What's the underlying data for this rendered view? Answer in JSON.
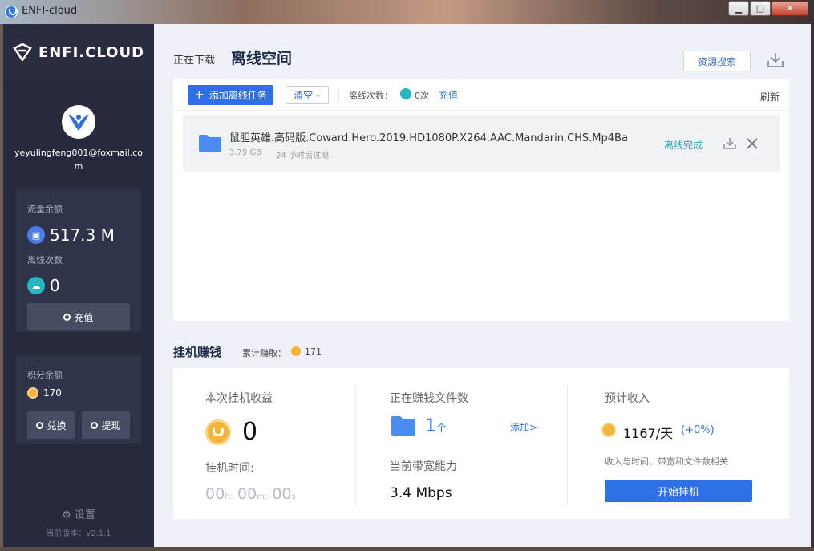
{
  "window": {
    "title": "ENFI-cloud",
    "min_label": "▁",
    "max_label": "□",
    "close_label": "✕"
  },
  "sidebar": {
    "brand": "ENFI.CLOUD",
    "username": "yeyulingfeng001@foxmail.com",
    "balance_card": {
      "traffic_label": "流量余额",
      "traffic_value": "517.3 M",
      "offline_label": "离线次数",
      "offline_value": "0",
      "recharge_label": "充值"
    },
    "points_card": {
      "label": "积分余额",
      "value": "170",
      "exchange_label": "兑换",
      "withdraw_label": "提现"
    },
    "settings_label": "设置",
    "version": "当前版本：v2.1.1"
  },
  "main": {
    "tab_downloading": "正在下载",
    "tab_offline": "离线空间",
    "resource_search": "资源搜索",
    "toolbar": {
      "add_task": "添加离线任务",
      "clear": "清空",
      "offline_count_label": "离线次数：",
      "offline_count_value": "0次",
      "recharge": "充值",
      "refresh": "刷新"
    },
    "tasks": [
      {
        "name": "鼠胆英雄.高码版.Coward.Hero.2019.HD1080P.X264.AAC.Mandarin.CHS.Mp4Ba",
        "size": "3.79 GB",
        "expire": "24 小时后过期",
        "status": "离线完成"
      }
    ],
    "earn": {
      "title": "挂机赚钱",
      "total_label": "累计赚取：",
      "total_value": "171",
      "session_label": "本次挂机收益",
      "session_value": "0",
      "time_label": "挂机时间:",
      "time_h": "00",
      "time_h_unit": "h:",
      "time_m": "00",
      "time_m_unit": "m:",
      "time_s": "00",
      "time_s_unit": "s",
      "files_label": "正在赚钱文件数",
      "files_value": "1",
      "files_unit": "个",
      "add_link": "添加>",
      "bandwidth_label": "当前带宽能力",
      "bandwidth_value": "3.4 Mbps",
      "estimate_label": "预计收入",
      "estimate_value": "1167/天",
      "estimate_pct": "(+0%)",
      "estimate_note": "收入与时间、带宽和文件数相关",
      "start_button": "开始挂机"
    }
  },
  "colors": {
    "sidebar_bg": "#272a3c",
    "accent_blue": "#2f6fe6",
    "teal": "#2ba6b3",
    "coin": "#f4b33a"
  }
}
